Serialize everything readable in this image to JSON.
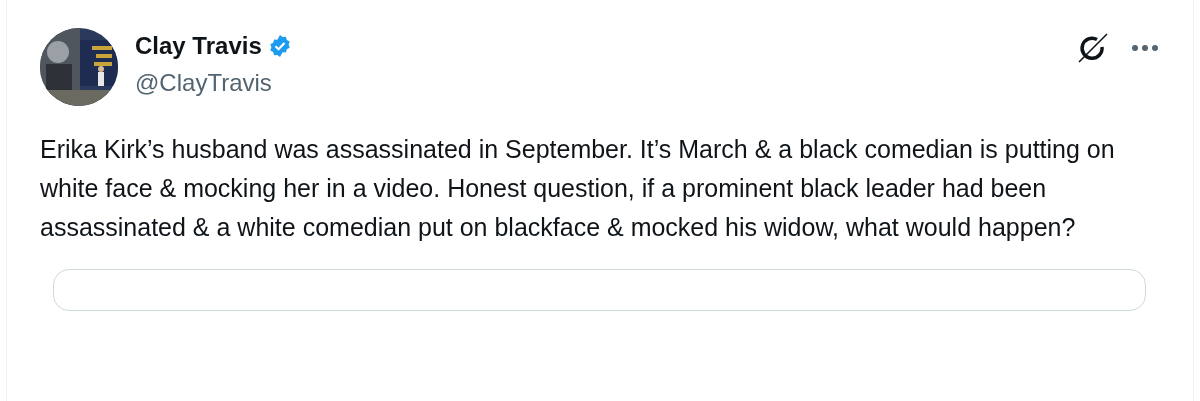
{
  "author": {
    "name": "Clay Travis",
    "verified": true,
    "handle": "@ClayTravis"
  },
  "text": "Erika Kirk’s husband was assassinated in September. It’s March & a black comedian is putting on white face & mocking her in a video. Honest question, if a prominent black leader had been assassinated & a white comedian put on blackface & mocked his widow, what would happen?"
}
